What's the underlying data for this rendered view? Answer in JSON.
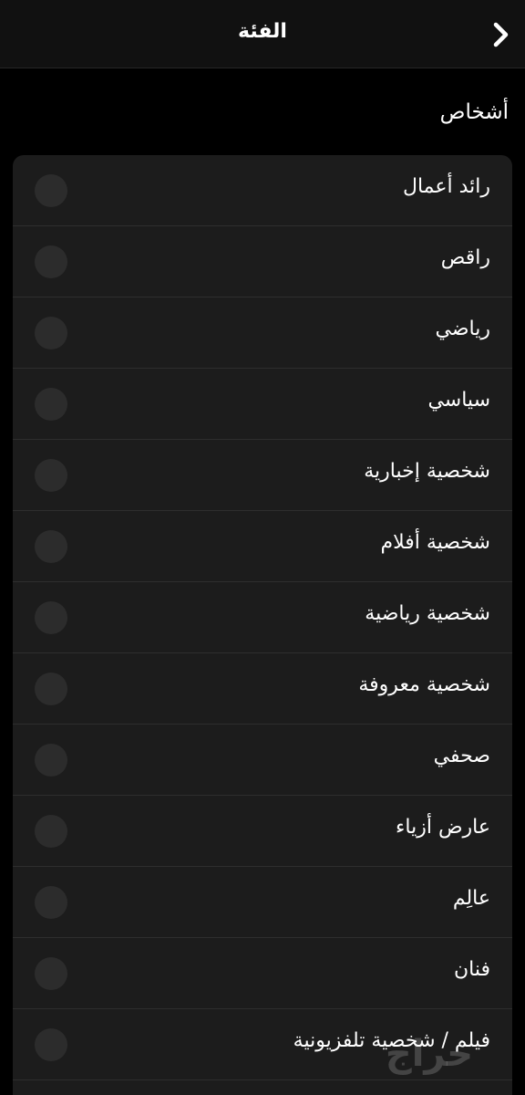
{
  "header": {
    "title": "الفئة",
    "back_icon": "chevron-back-icon"
  },
  "section": {
    "title": "أشخاص"
  },
  "options": [
    "رائد أعمال",
    "راقص",
    "رياضي",
    "سياسي",
    "شخصية إخبارية",
    "شخصية أفلام",
    "شخصية رياضية",
    "شخصية معروفة",
    "صحفي",
    "عارض أزياء",
    "عالِم",
    "فنان",
    "فيلم / شخصية تلفزيونية"
  ],
  "watermark": {
    "text": "حراج"
  },
  "colors": {
    "background": "#000000",
    "header": "#111111",
    "list": "#1c1c1c",
    "radio": "#2c2c2c",
    "divider": "#2e2e2e"
  }
}
